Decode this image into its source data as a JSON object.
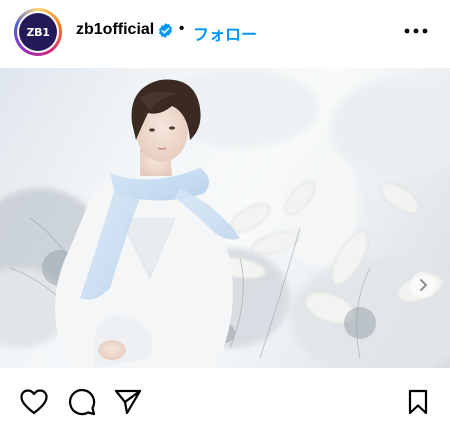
{
  "post": {
    "avatar_text": "ZB1",
    "username": "zb1official",
    "separator": "•",
    "follow_label": "フォロー"
  },
  "icons": {
    "verified": "verified-badge-icon",
    "more": "more-options-icon",
    "like": "heart-icon",
    "comment": "comment-icon",
    "share": "paper-plane-icon",
    "save": "bookmark-icon",
    "carousel_next": "chevron-right-icon"
  },
  "colors": {
    "accent": "#0095f6",
    "text": "#000000"
  }
}
